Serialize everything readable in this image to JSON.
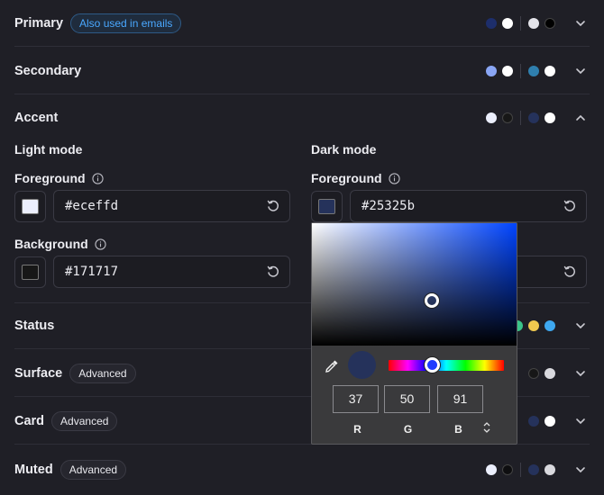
{
  "sections": {
    "primary": {
      "title": "Primary",
      "badge": "Also used in emails"
    },
    "secondary": {
      "title": "Secondary"
    },
    "accent": {
      "title": "Accent"
    },
    "status": {
      "title": "Status"
    },
    "surface": {
      "title": "Surface",
      "badge": "Advanced"
    },
    "card": {
      "title": "Card",
      "badge": "Advanced"
    },
    "muted": {
      "title": "Muted",
      "badge": "Advanced"
    }
  },
  "accent": {
    "light_mode": "Light mode",
    "dark_mode": "Dark mode",
    "light_fg_label": "Foreground",
    "light_fg_value": "#eceffd",
    "light_bg_label": "Background",
    "light_bg_value": "#171717",
    "dark_fg_label": "Foreground",
    "dark_fg_value": "#25325b"
  },
  "picker": {
    "r": "37",
    "g": "50",
    "b": "91",
    "r_label": "R",
    "g_label": "G",
    "b_label": "B",
    "preview_color": "#25325b"
  },
  "colors": {
    "primary_dots": [
      "#1d2e6b",
      "#ffffff",
      "#e4e4ea",
      "#000000"
    ],
    "secondary_dots": [
      "#8aa6f5",
      "#ffffff",
      "#2f7fae",
      "#ffffff"
    ],
    "accent_dots": [
      "#eceffd",
      "#171717",
      "#25325b",
      "#ffffff"
    ],
    "status_dots": [
      "#3bc48a",
      "#f0c94f",
      "#3ea8f0"
    ],
    "surface_dots": [
      "#171717",
      "#d9d9de"
    ],
    "card_dots": [
      "#25325b",
      "#ffffff"
    ],
    "muted_dots": [
      "#eceffd",
      "#0e0e10",
      "#25325b",
      "#d9d9de"
    ]
  }
}
